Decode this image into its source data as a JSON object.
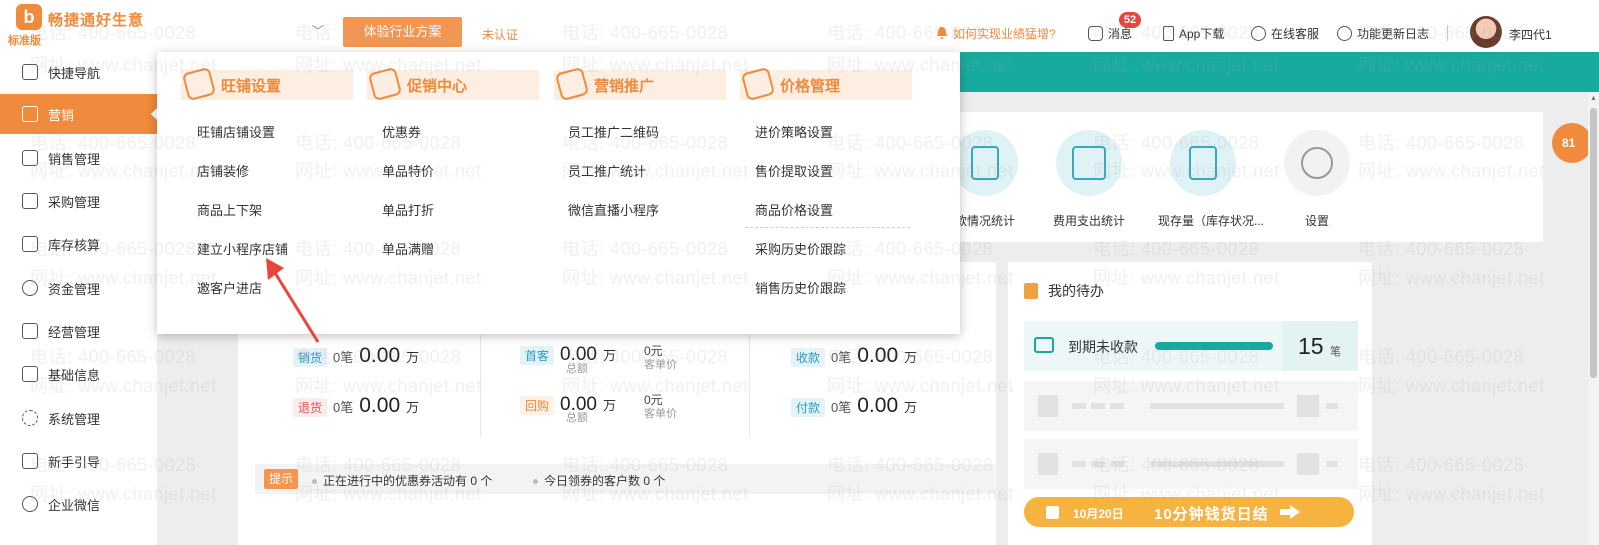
{
  "brand": {
    "mark": "b",
    "name": "畅捷通好生意",
    "edition": "标准版"
  },
  "topbar": {
    "solution_button": "体验行业方案",
    "unverified": "未认证",
    "growth_link": "如何实现业绩猛增?",
    "messages": "消息",
    "message_count": "52",
    "app_download": "App下载",
    "online_service": "在线客服",
    "update_log": "功能更新日志",
    "username": "李四代1"
  },
  "sidebar": {
    "items": [
      {
        "label": "快捷导航",
        "icon": "home-icon"
      },
      {
        "label": "营销",
        "icon": "gift-icon"
      },
      {
        "label": "销售管理",
        "icon": "sales-icon"
      },
      {
        "label": "采购管理",
        "icon": "purchase-icon"
      },
      {
        "label": "库存核算",
        "icon": "warehouse-icon"
      },
      {
        "label": "资金管理",
        "icon": "yen-icon"
      },
      {
        "label": "经营管理",
        "icon": "document-icon"
      },
      {
        "label": "基础信息",
        "icon": "id-card-icon"
      },
      {
        "label": "系统管理",
        "icon": "cycle-icon"
      },
      {
        "label": "新手引导",
        "icon": "guide-icon"
      },
      {
        "label": "企业微信",
        "icon": "wechat-work-icon"
      }
    ],
    "active_index": 1
  },
  "menu": {
    "columns": [
      {
        "title": "旺铺设置",
        "items": [
          "旺铺店铺设置",
          "店铺装修",
          "商品上下架",
          "建立小程序店铺",
          "邀客户进店"
        ]
      },
      {
        "title": "促销中心",
        "items": [
          "优惠券",
          "单品特价",
          "单品打折",
          "单品满赠"
        ]
      },
      {
        "title": "营销推广",
        "items": [
          "员工推广二维码",
          "员工推广统计",
          "微信直播小程序"
        ]
      },
      {
        "title": "价格管理",
        "items": [
          "进价策略设置",
          "售价提取设置",
          "商品价格设置",
          "采购历史价跟踪",
          "销售历史价跟踪"
        ]
      }
    ]
  },
  "functions": [
    {
      "label": "款情况统计",
      "icon": "income-chart-icon"
    },
    {
      "label": "费用支出统计",
      "icon": "expense-icon"
    },
    {
      "label": "现存量（库存状况...",
      "icon": "inventory-icon"
    },
    {
      "label": "设置",
      "icon": "settings-icon"
    }
  ],
  "stats": {
    "sales": {
      "tag": "销货",
      "count": "0笔",
      "amount": "0.00",
      "unit": "万"
    },
    "returns": {
      "tag": "退货",
      "count": "0笔",
      "amount": "0.00",
      "unit": "万"
    },
    "first_customer": {
      "tag": "首客",
      "amount": "0.00",
      "unit": "万",
      "amount_label": "总额",
      "price": "0元",
      "price_label": "客单价"
    },
    "repeat_customer": {
      "tag": "回购",
      "amount": "0.00",
      "unit": "万",
      "amount_label": "总额",
      "price": "0元",
      "price_label": "客单价"
    },
    "receipts": {
      "tag": "收款",
      "count": "0笔",
      "amount": "0.00",
      "unit": "万"
    },
    "payments": {
      "tag": "付款",
      "count": "0笔",
      "amount": "0.00",
      "unit": "万"
    }
  },
  "tips": {
    "tag": "提示",
    "coupon_activities": "正在进行中的优惠券活动有 0 个",
    "coupon_customers": "今日领券的客户数 0 个"
  },
  "todo": {
    "title": "我的待办",
    "overdue_label": "到期未收款",
    "overdue_count": "15",
    "overdue_unit": "笔",
    "promo_date": "10月20日",
    "promo_text": "10分钟钱货日结"
  },
  "side_badge": "81",
  "watermark": {
    "phone": "电话: 400-665-0028",
    "site": "网址: www.chanjet.net"
  },
  "colors": {
    "brand_orange": "#f08a3c",
    "teal": "#17ab9f",
    "badge_red": "#e8463d",
    "promo_yellow": "#f7b340"
  }
}
